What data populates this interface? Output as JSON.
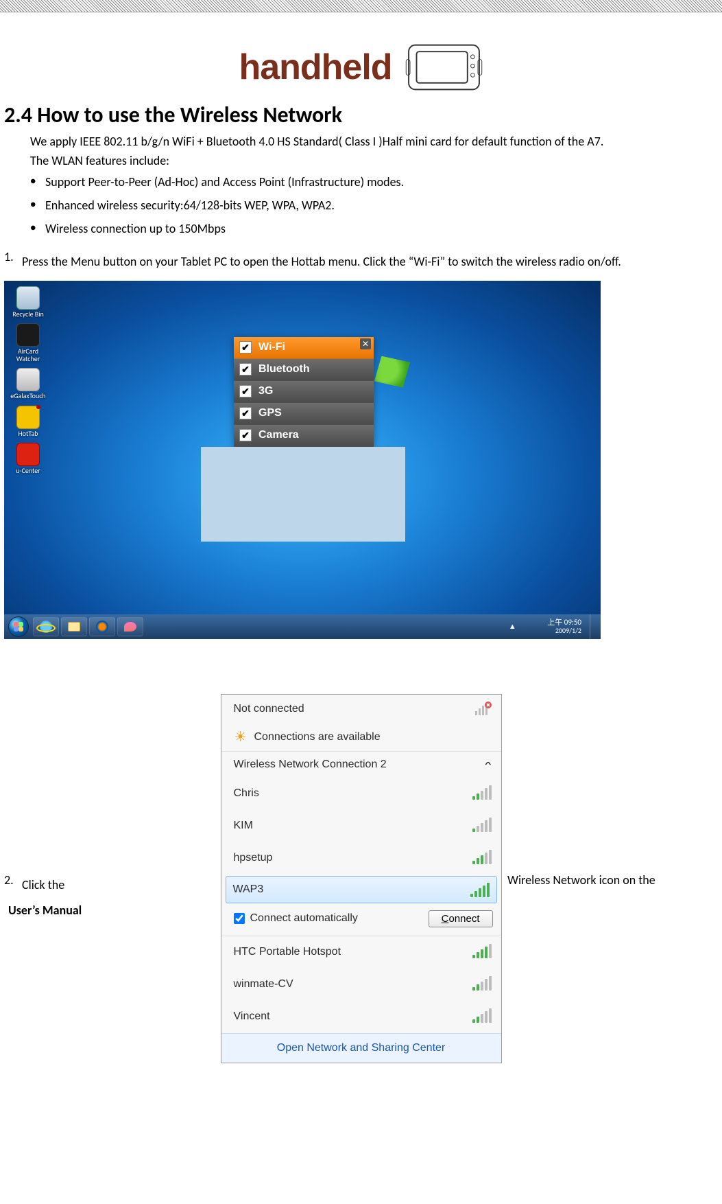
{
  "logo_text": "handheld",
  "section_title": "2.4 How to use the Wireless Network",
  "intro_text": "We apply IEEE 802.11 b/g/n WiFi + Bluetooth 4.0 HS Standard( Class I )Half mini card for default function of the A7.",
  "features_intro": "The WLAN features include:",
  "bullets": [
    "Support Peer-to-Peer (Ad-Hoc) and Access Point (Infrastructure) modes.",
    "Enhanced wireless security:64/128-bits WEP, WPA, WPA2.",
    "Wireless connection up to 150Mbps"
  ],
  "steps": {
    "one_num": "1.",
    "one_body": "Press the Menu button on your Tablet PC to open the Hottab menu. Click the “Wi-Fi” to switch the wireless radio on/off.",
    "two_num": "2.",
    "two_left": "Click the",
    "two_right": "Wireless Network icon on the"
  },
  "footer_label": "User’s Manual",
  "desktop": {
    "icons": [
      {
        "label": "Recycle Bin",
        "cls": "recycle"
      },
      {
        "label": "AirCard Watcher",
        "cls": "air"
      },
      {
        "label": "eGalaxTouch",
        "cls": "egalax"
      },
      {
        "label": "HotTab",
        "cls": "hottab"
      },
      {
        "label": "u-Center",
        "cls": "ucenter"
      }
    ],
    "hottab": {
      "close": "✕",
      "items": [
        {
          "label": "Wi-Fi",
          "checked": true,
          "active": true
        },
        {
          "label": "Bluetooth",
          "checked": true,
          "active": false
        },
        {
          "label": "3G",
          "checked": true,
          "active": false
        },
        {
          "label": "GPS",
          "checked": true,
          "active": false
        },
        {
          "label": "Camera",
          "checked": true,
          "active": false
        }
      ]
    },
    "tray": {
      "time": "上午 09:50",
      "date": "2009/1/2",
      "up": "▲"
    }
  },
  "flyout": {
    "not_connected": "Not connected",
    "available": "Connections are available",
    "section": "Wireless Network Connection 2",
    "collapse": "^",
    "networks": [
      {
        "name": "Chris",
        "bars": "g2"
      },
      {
        "name": "KIM",
        "bars": "g1"
      },
      {
        "name": "hpsetup",
        "bars": "g3"
      }
    ],
    "selected": {
      "name": "WAP3",
      "bars": "g5"
    },
    "connect_row": {
      "auto_label": "Connect automatically",
      "auto_checked": true,
      "btn_pre": "C",
      "btn_rest": "onnect"
    },
    "networks_after": [
      {
        "name": "HTC Portable Hotspot",
        "bars": "g4"
      },
      {
        "name": "winmate-CV",
        "bars": "g2"
      },
      {
        "name": "Vincent",
        "bars": "g2"
      }
    ],
    "footer": "Open Network and Sharing Center"
  }
}
